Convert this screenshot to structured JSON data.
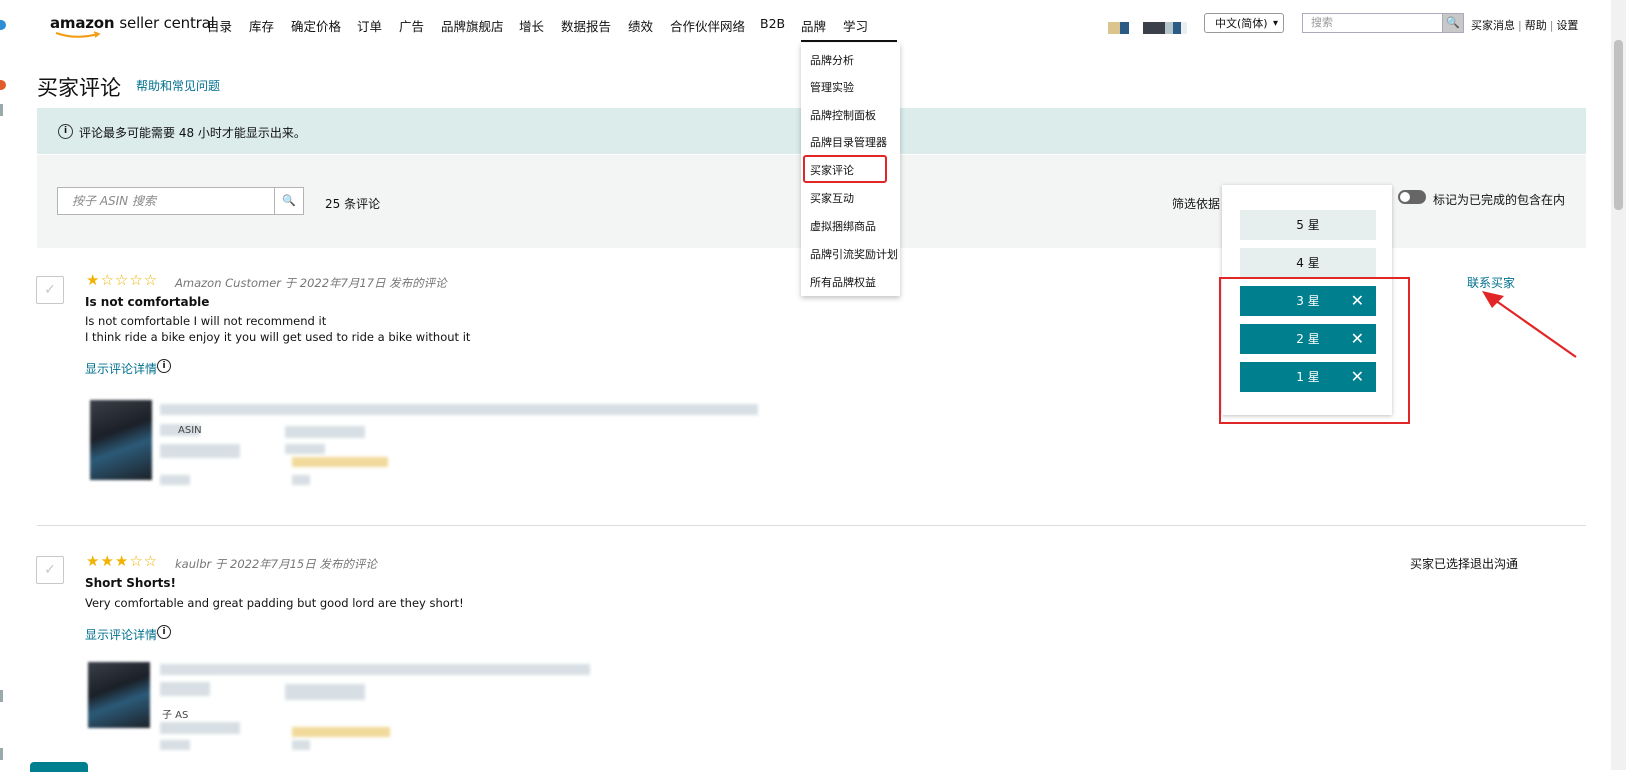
{
  "header": {
    "logo_brand": "amazon",
    "logo_product": "seller central",
    "nav": [
      "目录",
      "库存",
      "确定价格",
      "订单",
      "广告",
      "品牌旗舰店",
      "增长",
      "数据报告",
      "绩效",
      "合作伙伴网络",
      "B2B",
      "品牌",
      "学习"
    ],
    "active_nav": "品牌",
    "language": "中文(简体)",
    "search_placeholder": "搜索",
    "links": [
      "买家消息",
      "帮助",
      "设置"
    ]
  },
  "brand_menu": {
    "items": [
      "品牌分析",
      "管理实验",
      "品牌控制面板",
      "品牌目录管理器",
      "买家评论",
      "买家互动",
      "虚拟捆绑商品",
      "品牌引流奖励计划",
      "所有品牌权益"
    ],
    "highlighted": "买家评论"
  },
  "page": {
    "title": "买家评论",
    "help_link": "帮助和常见问题",
    "info_banner": "评论最多可能需要 48 小时才能显示出来。",
    "asin_placeholder": "按子 ASIN 搜索",
    "review_count": "25 条评论",
    "filter_label": "筛选依据",
    "toggle_label": "标记为已完成的包含在内",
    "toggle_on": false
  },
  "star_filter": {
    "options": [
      {
        "label": "5 星",
        "selected": false
      },
      {
        "label": "4 星",
        "selected": false
      },
      {
        "label": "3 星",
        "selected": true
      },
      {
        "label": "2 星",
        "selected": true
      },
      {
        "label": "1 星",
        "selected": true
      }
    ],
    "remove_glyph": "✕"
  },
  "reviews": [
    {
      "rating": 1,
      "meta": "Amazon Customer 于 2022年7月17日 发布的评论",
      "title": "Is not comfortable",
      "body": [
        "Is not comfortable I will not recommend it",
        "I think ride a bike enjoy it you will get used to ride a bike without it"
      ],
      "detail_link": "显示评论详情",
      "product_label": "ASIN",
      "action": "联系买家"
    },
    {
      "rating": 3,
      "meta": "kaulbr 于 2022年7月15日 发布的评论",
      "title": "Short Shorts!",
      "body": [
        "Very comfortable and great padding but good lord are they short!"
      ],
      "detail_link": "显示评论详情",
      "product_label": "子 AS",
      "action": "买家已选择退出沟通"
    }
  ],
  "colors": {
    "teal": "#00808e",
    "link": "#00708f",
    "highlight_red": "#e02626",
    "star": "#f1b300",
    "banner_bg": "#dbeceb"
  }
}
